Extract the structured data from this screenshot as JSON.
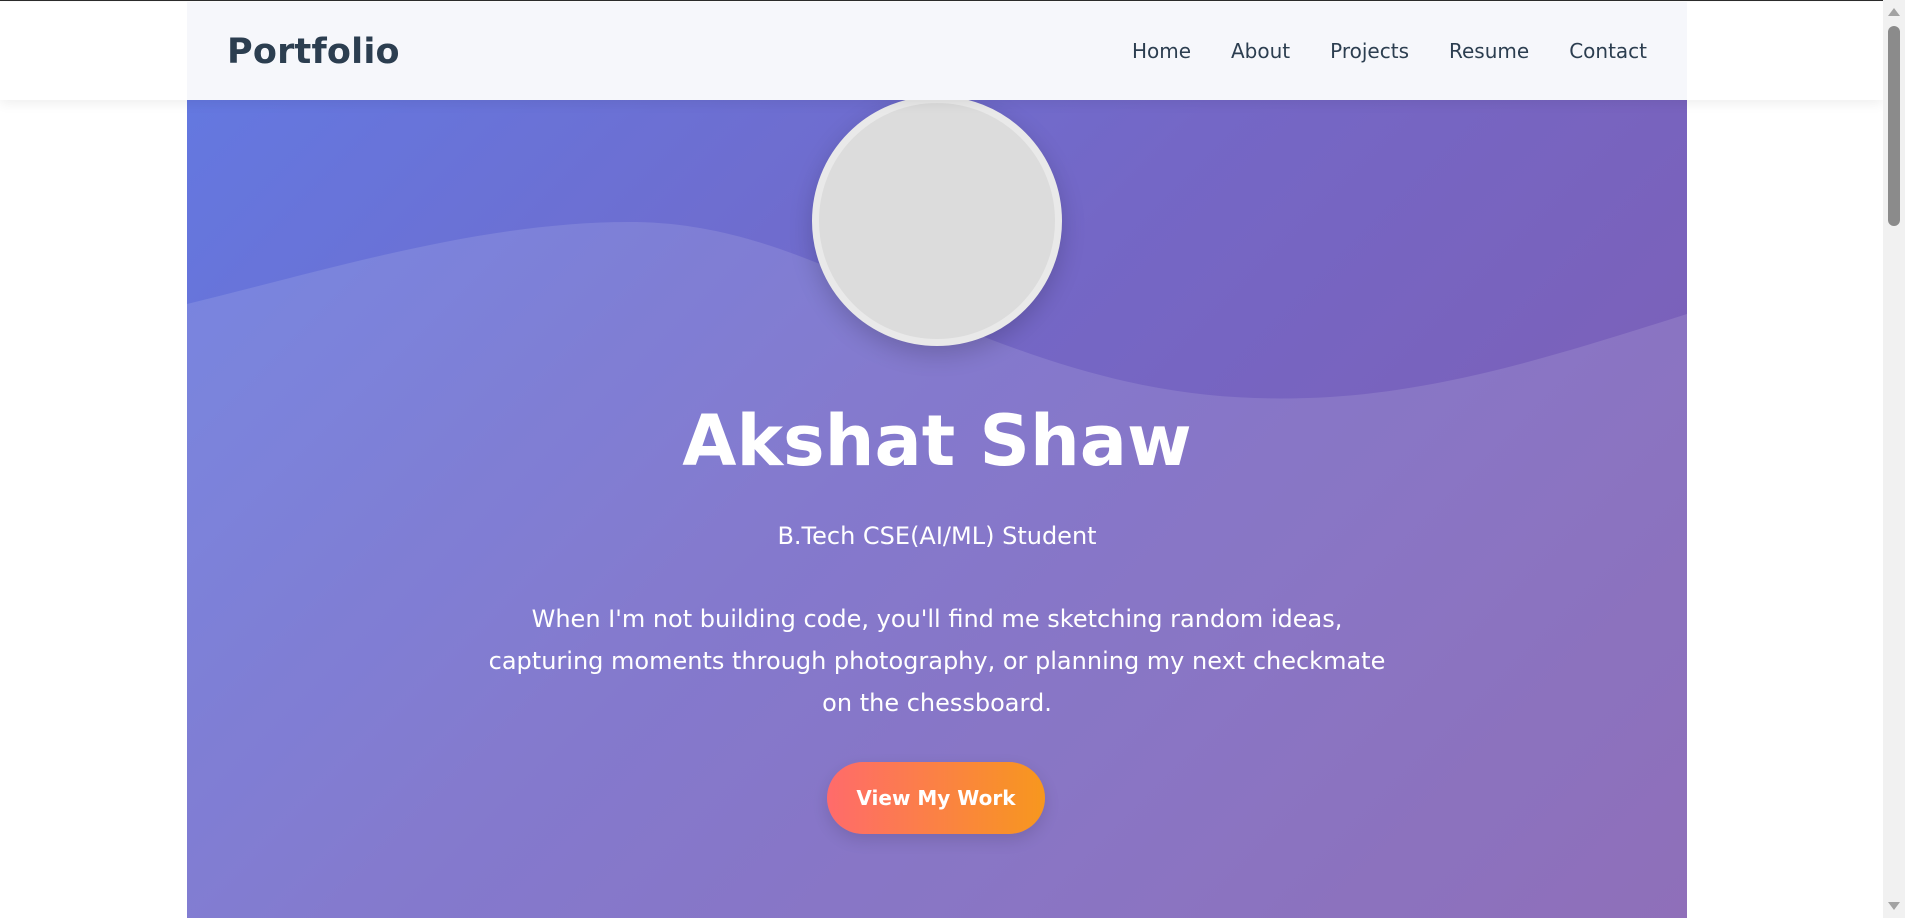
{
  "navbar": {
    "brand": "Portfolio",
    "links": [
      "Home",
      "About",
      "Projects",
      "Resume",
      "Contact"
    ]
  },
  "hero": {
    "name": "Akshat Shaw",
    "subtitle": "B.Tech CSE(AI/ML) Student",
    "bio": "When I'm not building code, you'll find me sketching random ideas, capturing moments through photography, or planning my next checkmate on the chessboard.",
    "cta_label": "View My Work"
  },
  "colors": {
    "brand_text": "#2c3e50",
    "hero_gradient_start": "#6478e0",
    "hero_gradient_end": "#805cb0",
    "cta_gradient_start": "#ff6b6b",
    "cta_gradient_end": "#f7971e"
  },
  "icons": {
    "avatar": "profile-photo-placeholder"
  }
}
